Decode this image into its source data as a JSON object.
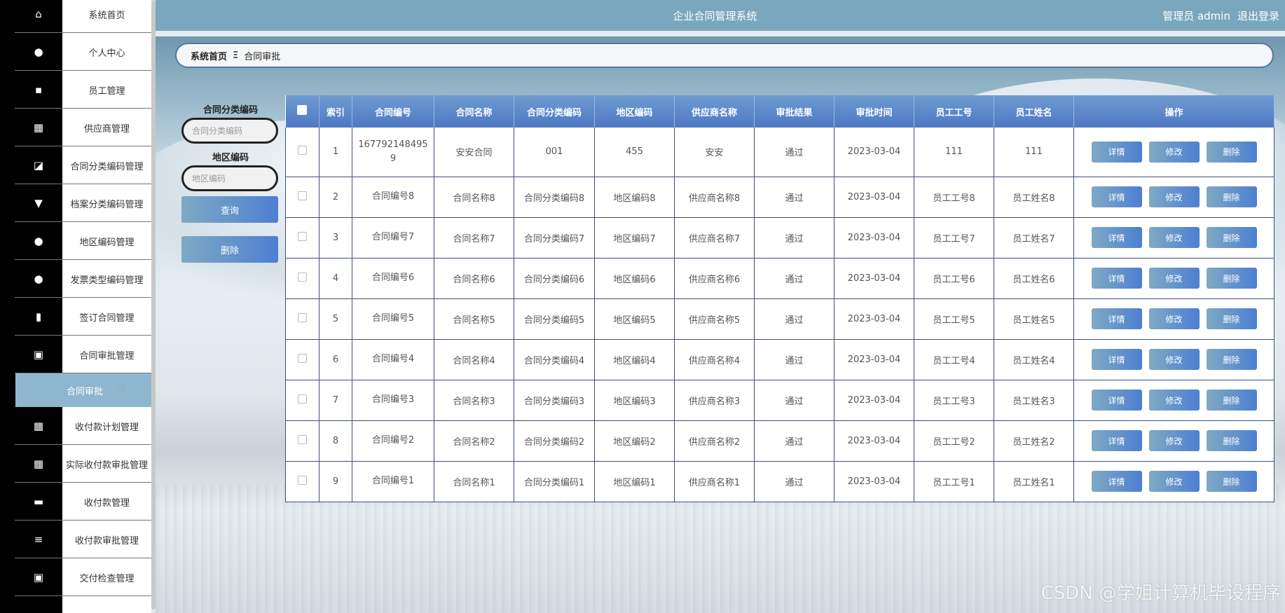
{
  "app": {
    "title": "企业合同管理系统",
    "user_label": "管理员 admin",
    "logout_label": "退出登录"
  },
  "sidebar": {
    "items": [
      {
        "label": "系统首页",
        "icon": "home-icon",
        "glyph": "⌂"
      },
      {
        "label": "个人中心",
        "icon": "user-icon",
        "glyph": "●"
      },
      {
        "label": "员工管理",
        "icon": "chat-icon",
        "glyph": "▪"
      },
      {
        "label": "供应商管理",
        "icon": "grid-icon",
        "glyph": "▦"
      },
      {
        "label": "合同分类编码管理",
        "icon": "chart-icon",
        "glyph": "◪"
      },
      {
        "label": "档案分类编码管理",
        "icon": "paint-icon",
        "glyph": "▼"
      },
      {
        "label": "地区编码管理",
        "icon": "person-icon",
        "glyph": "●"
      },
      {
        "label": "发票类型编码管理",
        "icon": "bulb-icon",
        "glyph": "●"
      },
      {
        "label": "签订合同管理",
        "icon": "bar-chart-icon",
        "glyph": "▮"
      },
      {
        "label": "合同审批管理",
        "icon": "clipboard-icon",
        "glyph": "▣"
      }
    ],
    "active_sub": "合同审批",
    "items_after": [
      {
        "label": "收付款计划管理",
        "icon": "grid-icon",
        "glyph": "▦"
      },
      {
        "label": "实际收付款审批管理",
        "icon": "grid-icon",
        "glyph": "▦"
      },
      {
        "label": "收付款管理",
        "icon": "monitor-icon",
        "glyph": "▬"
      },
      {
        "label": "收付款审批管理",
        "icon": "list-icon",
        "glyph": "≡"
      },
      {
        "label": "交付检查管理",
        "icon": "checklist-icon",
        "glyph": "▣"
      }
    ]
  },
  "breadcrumb": {
    "home": "系统首页",
    "separator": "Ξ",
    "current": "合同审批"
  },
  "search": {
    "field1_label": "合同分类编码",
    "field1_placeholder": "合同分类编码",
    "field2_label": "地区编码",
    "field2_placeholder": "地区编码",
    "query_button": "查询",
    "delete_button": "删除"
  },
  "table": {
    "columns": [
      "索引",
      "合同编号",
      "合同名称",
      "合同分类编码",
      "地区编码",
      "供应商名称",
      "审批结果",
      "审批时间",
      "员工工号",
      "员工姓名",
      "操作"
    ],
    "actions": {
      "detail": "详情",
      "edit": "修改",
      "delete": "删除"
    },
    "rows": [
      [
        "1",
        "1677921484959",
        "安安合同",
        "001",
        "455",
        "安安",
        "通过",
        "2023-03-04",
        "111",
        "111"
      ],
      [
        "2",
        "合同编号8",
        "合同名称8",
        "合同分类编码8",
        "地区编码8",
        "供应商名称8",
        "通过",
        "2023-03-04",
        "员工工号8",
        "员工姓名8"
      ],
      [
        "3",
        "合同编号7",
        "合同名称7",
        "合同分类编码7",
        "地区编码7",
        "供应商名称7",
        "通过",
        "2023-03-04",
        "员工工号7",
        "员工姓名7"
      ],
      [
        "4",
        "合同编号6",
        "合同名称6",
        "合同分类编码6",
        "地区编码6",
        "供应商名称6",
        "通过",
        "2023-03-04",
        "员工工号6",
        "员工姓名6"
      ],
      [
        "5",
        "合同编号5",
        "合同名称5",
        "合同分类编码5",
        "地区编码5",
        "供应商名称5",
        "通过",
        "2023-03-04",
        "员工工号5",
        "员工姓名5"
      ],
      [
        "6",
        "合同编号4",
        "合同名称4",
        "合同分类编码4",
        "地区编码4",
        "供应商名称4",
        "通过",
        "2023-03-04",
        "员工工号4",
        "员工姓名4"
      ],
      [
        "7",
        "合同编号3",
        "合同名称3",
        "合同分类编码3",
        "地区编码3",
        "供应商名称3",
        "通过",
        "2023-03-04",
        "员工工号3",
        "员工姓名3"
      ],
      [
        "8",
        "合同编号2",
        "合同名称2",
        "合同分类编码2",
        "地区编码2",
        "供应商名称2",
        "通过",
        "2023-03-04",
        "员工工号2",
        "员工姓名2"
      ],
      [
        "9",
        "合同编号1",
        "合同名称1",
        "合同分类编码1",
        "地区编码1",
        "供应商名称1",
        "通过",
        "2023-03-04",
        "员工工号1",
        "员工姓名1"
      ]
    ]
  },
  "watermark": "CSDN @学姐计算机毕设程序"
}
